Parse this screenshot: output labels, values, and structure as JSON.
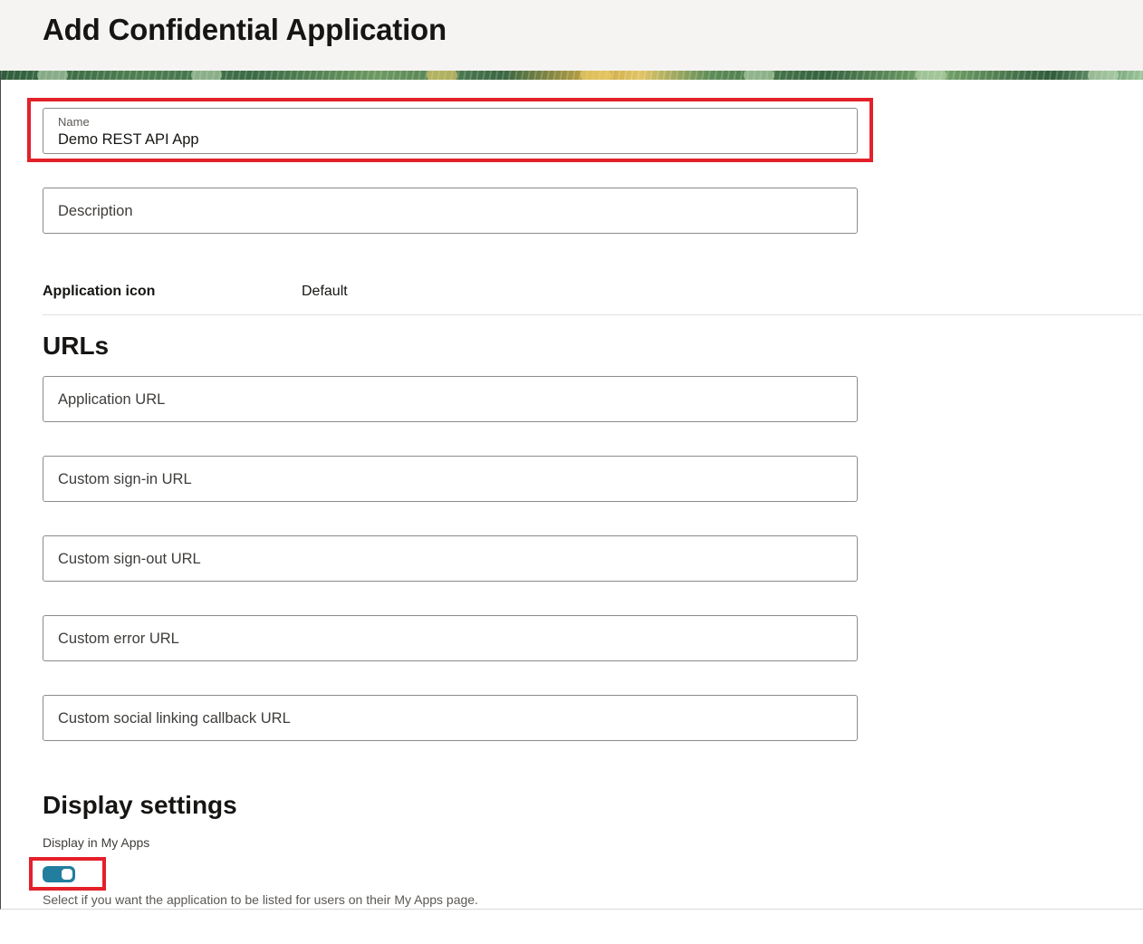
{
  "page": {
    "title": "Add Confidential Application"
  },
  "form": {
    "name": {
      "label": "Name",
      "value": "Demo REST API App"
    },
    "description": {
      "placeholder": "Description"
    },
    "application_icon": {
      "label": "Application icon",
      "value": "Default"
    }
  },
  "urls": {
    "heading": "URLs",
    "fields": [
      {
        "placeholder": "Application URL"
      },
      {
        "placeholder": "Custom sign-in URL"
      },
      {
        "placeholder": "Custom sign-out URL"
      },
      {
        "placeholder": "Custom error URL"
      },
      {
        "placeholder": "Custom social linking callback URL"
      }
    ]
  },
  "display_settings": {
    "heading": "Display settings",
    "toggle_label": "Display in My Apps",
    "toggle_on": true,
    "help_text": "Select if you want the application to be listed for users on their My Apps page."
  },
  "colors": {
    "highlight": "#e4202a",
    "toggle_on": "#227e9e",
    "field_border": "#8e8b87"
  }
}
